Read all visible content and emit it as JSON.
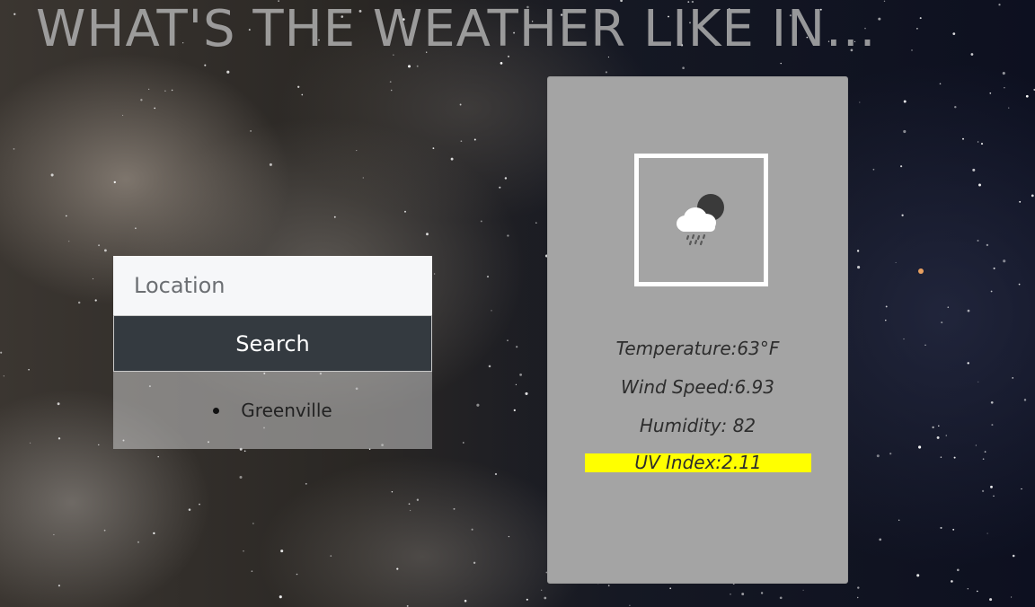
{
  "page": {
    "heading": "WHAT'S THE WEATHER LIKE IN..."
  },
  "search": {
    "placeholder": "Location",
    "value": "",
    "button_label": "Search",
    "history": [
      "Greenville"
    ]
  },
  "weather": {
    "icon": "rain-cloud-night-icon",
    "temperature": "Temperature:63°F",
    "wind_speed": "Wind Speed:6.93",
    "humidity": "Humidity: 82",
    "uv_index": "UV Index:2.11",
    "uv_color": "#ffff00"
  },
  "colors": {
    "card_bg": "#a4a4a4",
    "button_bg": "#343a40",
    "input_bg": "#f6f7f9"
  }
}
